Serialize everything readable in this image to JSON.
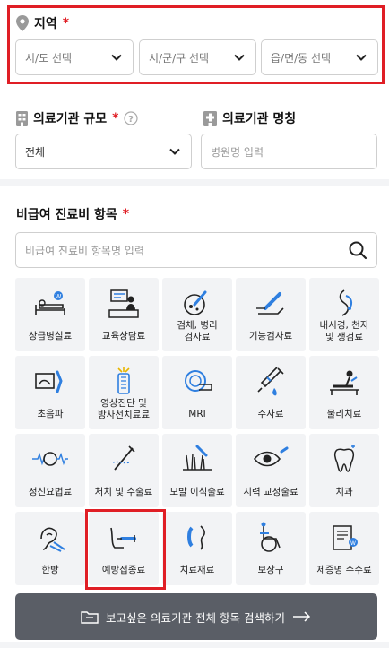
{
  "region": {
    "label": "지역",
    "required_mark": "*",
    "sido_placeholder": "시/도 선택",
    "sigungu_placeholder": "시/군/구 선택",
    "eupmyeondong_placeholder": "읍/면/동 선택"
  },
  "size": {
    "label": "의료기관 규모",
    "required_mark": "*",
    "selected": "전체"
  },
  "name": {
    "label": "의료기관 명칭",
    "placeholder": "병원명 입력"
  },
  "items": {
    "label": "비급여 진료비 항목",
    "required_mark": "*",
    "search_placeholder": "비급여 진료비 항목명 입력",
    "categories": [
      {
        "line1": "상급병실료",
        "line2": "",
        "icon": "hospital-bed-icon"
      },
      {
        "line1": "교육상담료",
        "line2": "",
        "icon": "counseling-icon"
      },
      {
        "line1": "검체, 병리",
        "line2": "검사료",
        "icon": "specimen-test-icon"
      },
      {
        "line1": "기능검사료",
        "line2": "",
        "icon": "function-test-icon"
      },
      {
        "line1": "내시경, 천자",
        "line2": "및 생검료",
        "icon": "endoscope-icon"
      },
      {
        "line1": "초음파",
        "line2": "",
        "icon": "ultrasound-icon"
      },
      {
        "line1": "영상진단 및",
        "line2": "방사선치료료",
        "icon": "imaging-icon"
      },
      {
        "line1": "MRI",
        "line2": "",
        "icon": "mri-icon"
      },
      {
        "line1": "주사료",
        "line2": "",
        "icon": "syringe-icon"
      },
      {
        "line1": "물리치료",
        "line2": "",
        "icon": "physical-therapy-icon"
      },
      {
        "line1": "정신요법료",
        "line2": "",
        "icon": "brain-wave-icon"
      },
      {
        "line1": "처치 및 수술료",
        "line2": "",
        "icon": "surgery-icon"
      },
      {
        "line1": "모발 이식술료",
        "line2": "",
        "icon": "hair-transplant-icon"
      },
      {
        "line1": "시력 교정술료",
        "line2": "",
        "icon": "eye-icon"
      },
      {
        "line1": "치과",
        "line2": "",
        "icon": "tooth-icon"
      },
      {
        "line1": "한방",
        "line2": "",
        "icon": "acupuncture-icon"
      },
      {
        "line1": "예방접종료",
        "line2": "",
        "icon": "vaccination-icon"
      },
      {
        "line1": "치료재료",
        "line2": "",
        "icon": "treatment-material-icon"
      },
      {
        "line1": "보장구",
        "line2": "",
        "icon": "wheelchair-icon"
      },
      {
        "line1": "제증명 수수료",
        "line2": "",
        "icon": "certificate-icon"
      }
    ]
  },
  "cta": {
    "label": "보고싶은 의료기관 전체 항목 검색하기"
  },
  "colors": {
    "accent_red": "#e01e25",
    "icon_blue": "#2f7fe0",
    "cell_bg": "#f2f3f5",
    "cta_bg": "#5a5e66"
  }
}
